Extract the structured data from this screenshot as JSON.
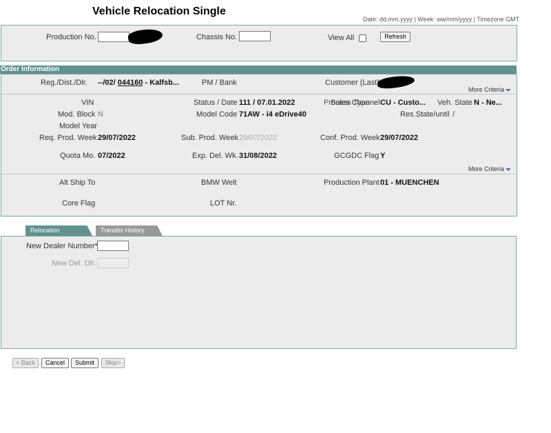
{
  "header": {
    "title": "Vehicle Relocation Single",
    "date_info": "Date: dd.mm.yyyy | Week: ww/mm/yyyy | Timezone GMT"
  },
  "search": {
    "production_no_label": "Production No.",
    "chassis_no_label": "Chassis No.",
    "view_all_label": "View All",
    "refresh_label": "Refresh"
  },
  "order": {
    "section_title": "Order Information",
    "reg_label": "Reg./Dist./Dlr.",
    "reg_prefix": "--/02/",
    "reg_dealer": "044160",
    "reg_suffix": "- Kalfsb...",
    "pm_bank_label": "PM / Bank",
    "customer_label": "Customer (Last)",
    "more_criteria_1": "More Criteria",
    "vin_label": "VIN",
    "status_date_label": "Status / Date",
    "status_date_value": "111 /  07.01.2022",
    "sales_channel_label": "Sales Channel",
    "process_type_label": "Process Type",
    "sales_channel_value": "CU - Custo...",
    "veh_state_label": "Veh. State",
    "veh_state_value": "N - Ne...",
    "mod_block_label": "Mod. Block",
    "mod_block_value": "N",
    "model_code_label": "Model Code",
    "model_code_value": "71AW - i4 eDrive40",
    "res_state_label": "Res.State/until",
    "res_state_value": "/",
    "model_year_label": "Model Year",
    "req_prod_week_label": "Req. Prod. Week",
    "req_prod_week_value": "29/07/2022",
    "sub_prod_week_label": "Sub. Prod. Week",
    "sub_prod_week_value": "29/07/2022",
    "conf_prod_week_label": "Conf. Prod. Week",
    "conf_prod_week_value": "29/07/2022",
    "quota_mo_label": "Quota Mo.",
    "quota_mo_value": "07/2022",
    "exp_del_wk_label": "Exp. Del. Wk.",
    "exp_del_wk_value": "31/08/2022",
    "gcgdc_flag_label": "GCGDC Flag",
    "gcgdc_flag_value": "Y",
    "more_criteria_2": "More Criteria",
    "alt_ship_to_label": "Alt Ship To",
    "bmw_welt_label": "BMW Welt",
    "production_plant_label": "Production Plant",
    "production_plant_value": "01 - MUENCHEN",
    "core_flag_label": "Core Flag",
    "lot_nr_label": "LOT Nr."
  },
  "tabs": [
    {
      "label": "Relocation",
      "active": true
    },
    {
      "label": "Transfer History",
      "active": false
    }
  ],
  "relocation": {
    "new_dealer_label": "New Dealer Number*",
    "new_del_dlr_label": "New Del. Dlr."
  },
  "actions": {
    "back": "< Back",
    "cancel": "Cancel",
    "submit": "Submit",
    "skip": "Skip>"
  },
  "colors": {
    "accent": "#5f9290",
    "panel_bg": "#ececec"
  }
}
